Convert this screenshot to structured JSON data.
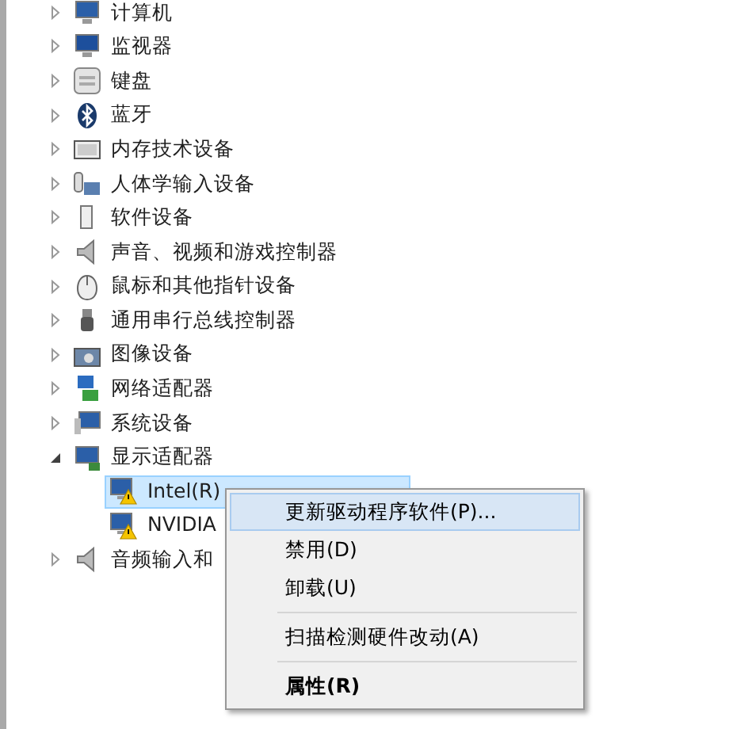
{
  "tree": [
    {
      "label": "计算机",
      "expanded": false
    },
    {
      "label": "监视器",
      "expanded": false
    },
    {
      "label": "键盘",
      "expanded": false
    },
    {
      "label": "蓝牙",
      "expanded": false
    },
    {
      "label": "内存技术设备",
      "expanded": false
    },
    {
      "label": "人体学输入设备",
      "expanded": false
    },
    {
      "label": "软件设备",
      "expanded": false
    },
    {
      "label": "声音、视频和游戏控制器",
      "expanded": false
    },
    {
      "label": "鼠标和其他指针设备",
      "expanded": false
    },
    {
      "label": "通用串行总线控制器",
      "expanded": false
    },
    {
      "label": "图像设备",
      "expanded": false
    },
    {
      "label": "网络适配器",
      "expanded": false
    },
    {
      "label": "系统设备",
      "expanded": false
    },
    {
      "label": "显示适配器",
      "expanded": true,
      "children": [
        {
          "label": "Intel(R)",
          "selected": true,
          "warning": true
        },
        {
          "label": "NVIDIA",
          "selected": false,
          "warning": true
        }
      ]
    },
    {
      "label": "音频输入和",
      "expanded": false
    }
  ],
  "context_menu": [
    {
      "kind": "item",
      "label": "更新驱动程序软件(P)...",
      "selected": true,
      "default": false
    },
    {
      "kind": "item",
      "label": "禁用(D)",
      "selected": false,
      "default": false
    },
    {
      "kind": "item",
      "label": "卸载(U)",
      "selected": false,
      "default": false
    },
    {
      "kind": "separator"
    },
    {
      "kind": "item",
      "label": "扫描检测硬件改动(A)",
      "selected": false,
      "default": false
    },
    {
      "kind": "separator"
    },
    {
      "kind": "item",
      "label": "属性(R)",
      "selected": false,
      "default": true
    }
  ]
}
